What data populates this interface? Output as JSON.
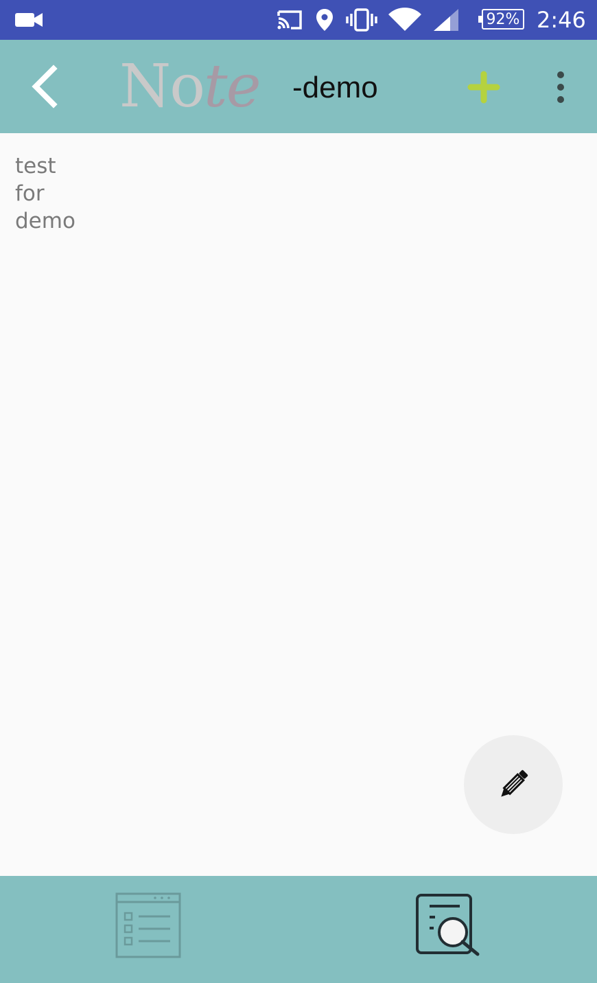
{
  "status_bar": {
    "icons": [
      "video-camera-icon",
      "cast-icon",
      "location-icon",
      "vibrate-icon",
      "wifi-icon",
      "signal-icon",
      "battery-icon"
    ],
    "battery_percent": "92%",
    "time": "2:46"
  },
  "app_bar": {
    "back_icon": "chevron-left-icon",
    "logo_text_a": "No",
    "logo_text_b": "te",
    "title": "-demo",
    "add_icon": "plus-icon",
    "add_color": "#b5d23f",
    "menu_icon": "more-vert-icon",
    "background": "#84bfc0"
  },
  "note": {
    "lines": [
      "test",
      "for",
      "demo"
    ]
  },
  "fab": {
    "icon": "pencil-icon"
  },
  "bottom_nav": {
    "items": [
      {
        "icon": "list-view-icon"
      },
      {
        "icon": "search-document-icon"
      }
    ],
    "background": "#84bfc0"
  },
  "colors": {
    "status_bar": "#3f51b5",
    "content_bg": "#fafafa",
    "note_text": "#7a7a7a"
  }
}
